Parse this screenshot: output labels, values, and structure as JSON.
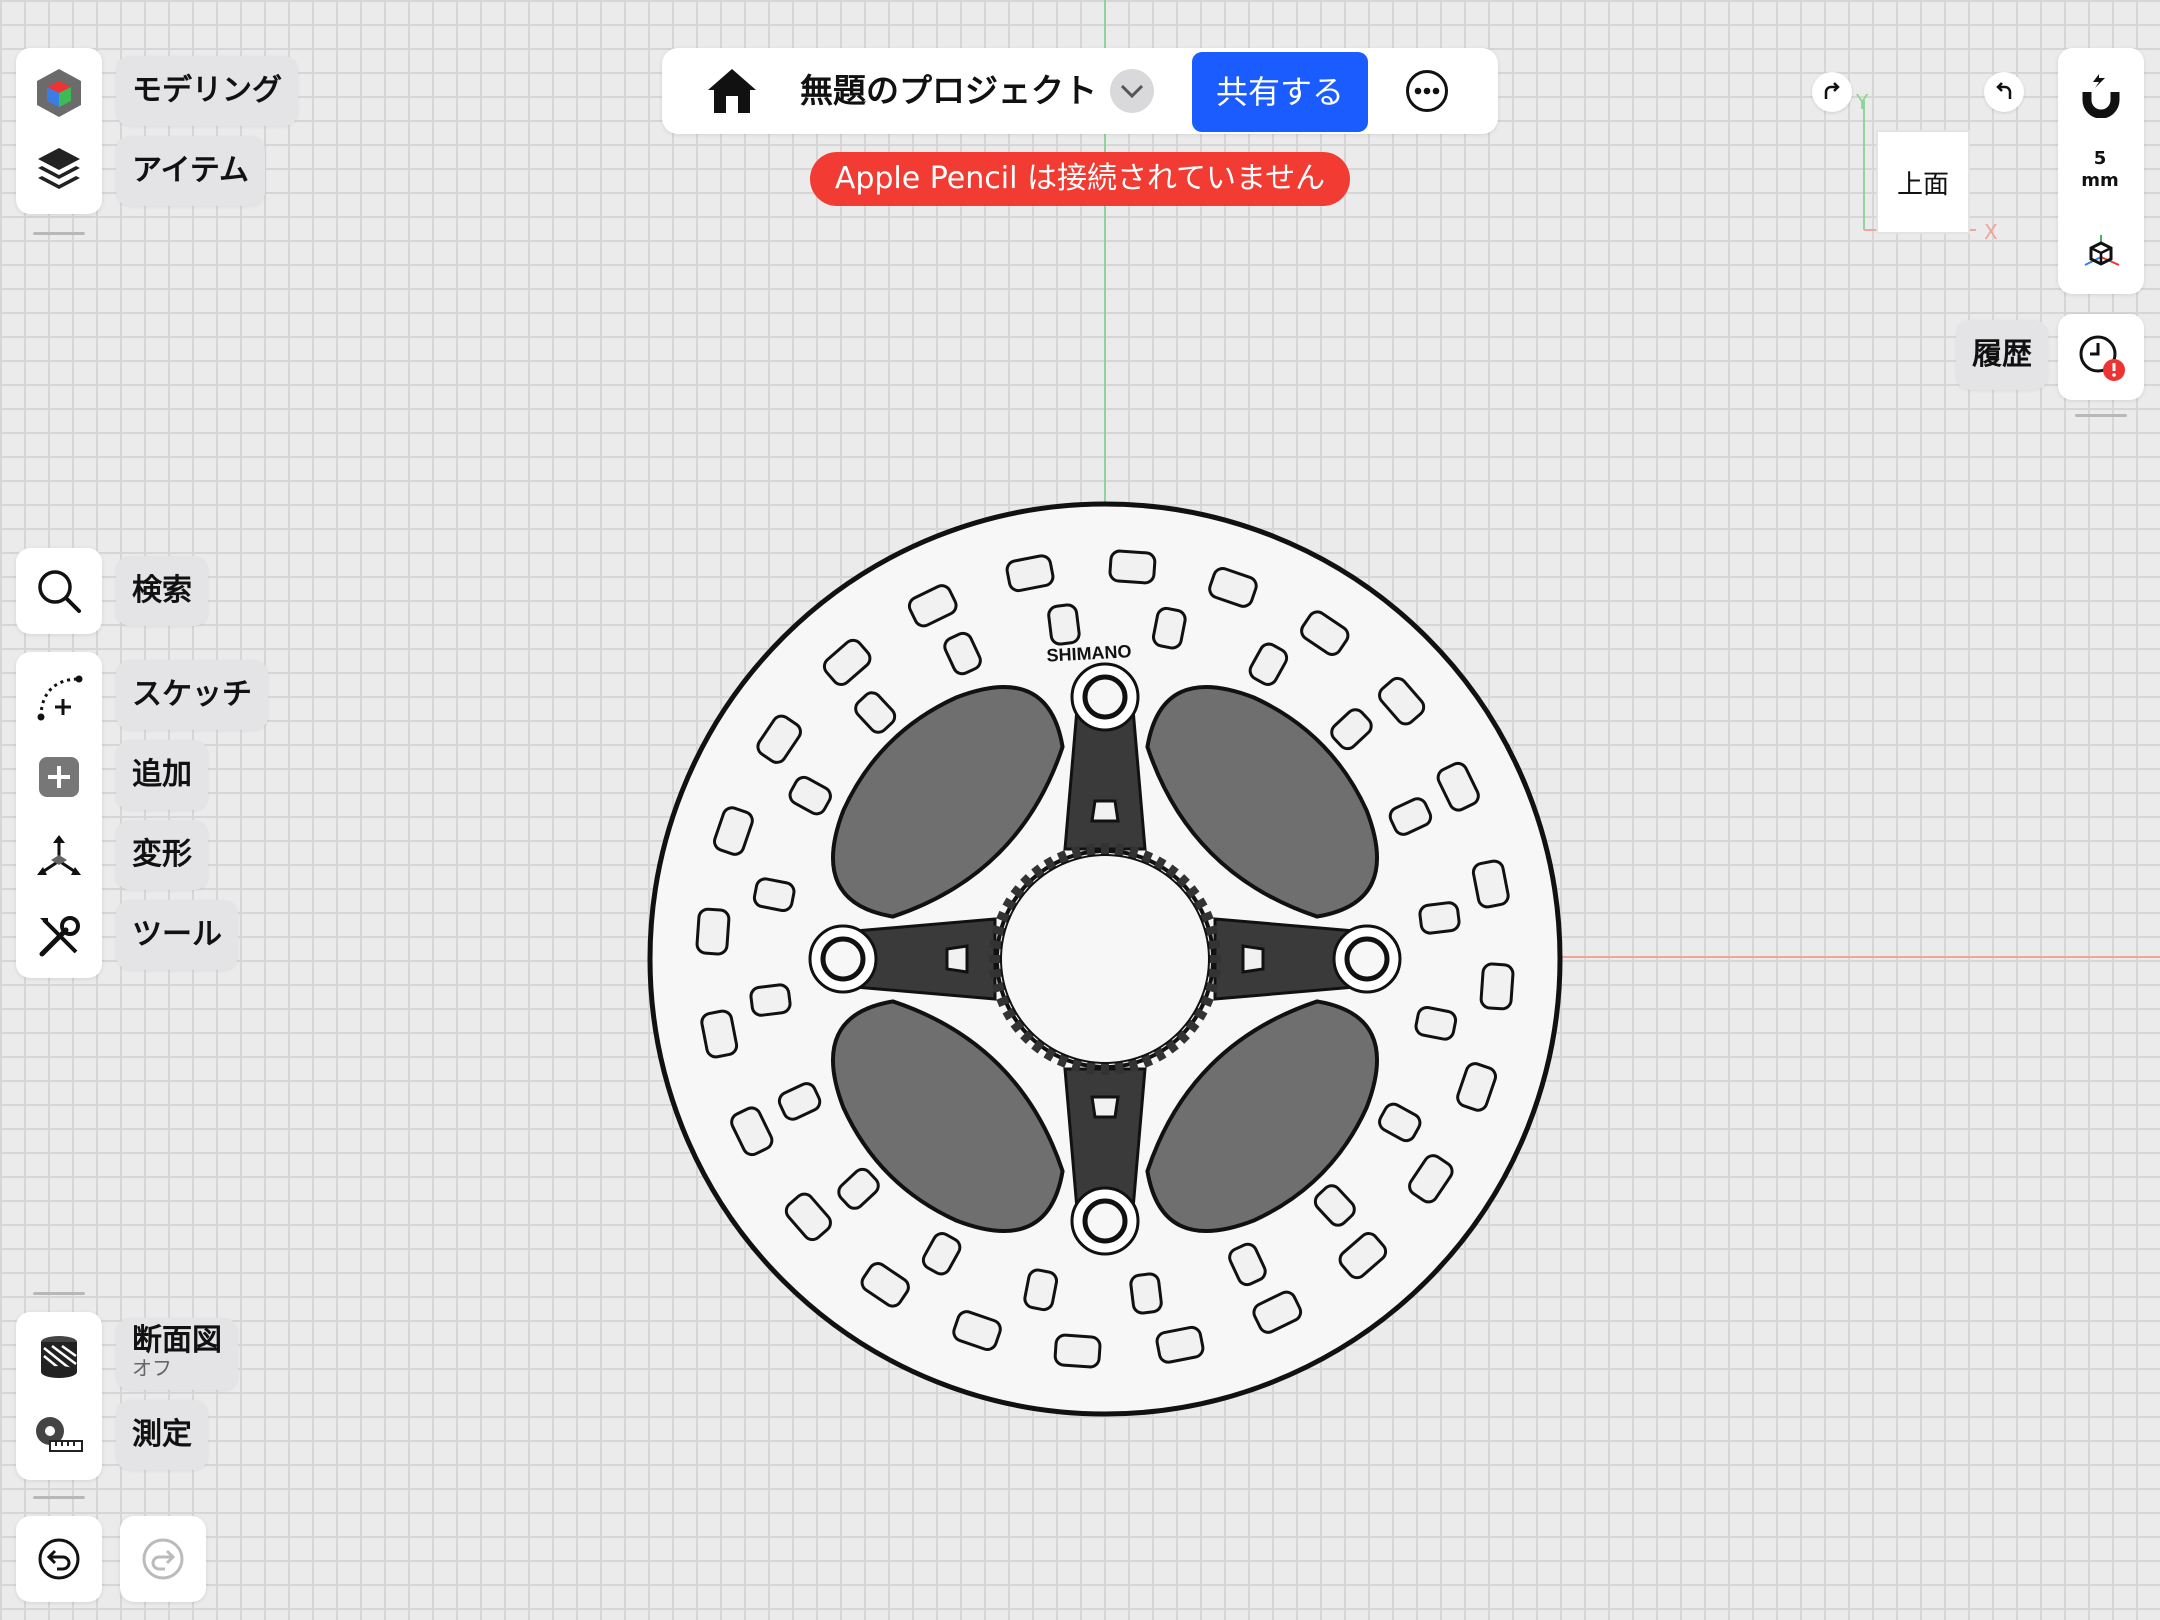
{
  "top_bar": {
    "project_title": "無題のプロジェクト",
    "share_label": "共有する"
  },
  "alert": {
    "text": "Apple Pencil は接続されていません"
  },
  "left_top": {
    "modeling_label": "モデリング",
    "items_label": "アイテム"
  },
  "left_tools": {
    "search_label": "検索",
    "sketch_label": "スケッチ",
    "add_label": "追加",
    "transform_label": "変形",
    "tools_label": "ツール"
  },
  "left_bottom": {
    "section_label": "断面図",
    "section_state": "オフ",
    "measure_label": "測定"
  },
  "view_cube": {
    "face_label": "上面",
    "axis_y": "Y",
    "axis_x": "X"
  },
  "right_panel": {
    "snap_value": "5",
    "snap_unit": "mm",
    "history_label": "履歴"
  },
  "model": {
    "logo_text": "SHIMANO"
  },
  "colors": {
    "accent": "#1a5cff",
    "alert": "#f23b32",
    "x_axis": "#f0a59a",
    "y_axis": "#8fd49a"
  },
  "icons": [
    "home-icon",
    "chevron-down-icon",
    "more-icon",
    "cube-icon",
    "layers-icon",
    "search-icon",
    "sketch-icon",
    "add-icon",
    "transform-icon",
    "tools-icon",
    "section-icon",
    "measure-icon",
    "undo-icon",
    "redo-icon",
    "magnet-icon",
    "orientation-icon",
    "history-icon"
  ]
}
